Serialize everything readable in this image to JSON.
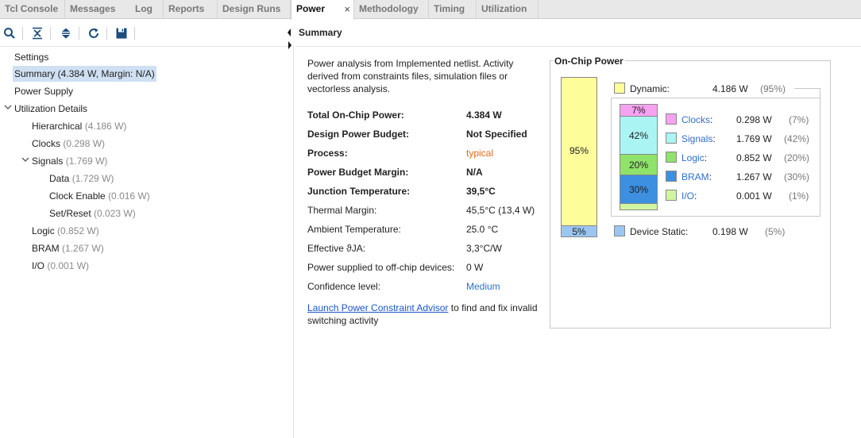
{
  "tabs": [
    {
      "label": "Tcl Console",
      "active": false
    },
    {
      "label": "Messages",
      "active": false
    },
    {
      "label": "Log",
      "active": false
    },
    {
      "label": "Reports",
      "active": false
    },
    {
      "label": "Design Runs",
      "active": false
    },
    {
      "label": "Power",
      "active": true
    },
    {
      "label": "Methodology",
      "active": false
    },
    {
      "label": "Timing",
      "active": false
    },
    {
      "label": "Utilization",
      "active": false
    }
  ],
  "tab_close_glyph": "×",
  "toolbar_icons": [
    "search-icon",
    "collapse-all-icon",
    "expand-all-icon",
    "refresh-icon",
    "save-icon"
  ],
  "tree": {
    "settings": "Settings",
    "summary": "Summary (4.384 W, Margin: N/A)",
    "power_supply": "Power Supply",
    "utilization_details": "Utilization Details",
    "hierarchical": {
      "name": "Hierarchical",
      "value": "(4.186 W)"
    },
    "clocks": {
      "name": "Clocks",
      "value": "(0.298 W)"
    },
    "signals": {
      "name": "Signals",
      "value": "(1.769 W)"
    },
    "data": {
      "name": "Data",
      "value": "(1.729 W)"
    },
    "clock_enable": {
      "name": "Clock Enable",
      "value": "(0.016 W)"
    },
    "set_reset": {
      "name": "Set/Reset",
      "value": "(0.023 W)"
    },
    "logic": {
      "name": "Logic",
      "value": "(0.852 W)"
    },
    "bram": {
      "name": "BRAM",
      "value": "(1.267 W)"
    },
    "io": {
      "name": "I/O",
      "value": "(0.001 W)"
    }
  },
  "summary": {
    "header": "Summary",
    "intro": "Power analysis from Implemented netlist. Activity derived from constraints files, simulation files or vectorless analysis.",
    "rows": [
      {
        "label": "Total On-Chip Power:",
        "value": "4.384 W"
      },
      {
        "label": "Design Power Budget:",
        "value": "Not Specified"
      },
      {
        "label": "Process:",
        "value": "typical"
      },
      {
        "label": "Power Budget Margin:",
        "value": "N/A"
      },
      {
        "label": "Junction Temperature:",
        "value": "39,5°C"
      },
      {
        "label": "Thermal Margin:",
        "value": "45,5°C (13,4 W)"
      },
      {
        "label": "Ambient Temperature:",
        "value": "25.0 °C"
      },
      {
        "label": "Effective ϑJA:",
        "value": "3,3°C/W"
      },
      {
        "label": "Power supplied to off-chip devices:",
        "value": "0 W"
      },
      {
        "label": "Confidence level:",
        "value": "Medium"
      }
    ],
    "link": "Launch Power Constraint Advisor",
    "link_suffix": " to find and fix invalid switching activity"
  },
  "on_chip_power": {
    "title": "On-Chip Power",
    "dynamic": {
      "label": "Dynamic:",
      "value": "4.186 W",
      "pct": "(95%)",
      "bar_label": "95%",
      "fraction": 0.95
    },
    "static": {
      "label": "Device Static:",
      "value": "0.198 W",
      "pct": "(5%)",
      "bar_label": "5%",
      "fraction": 0.05
    },
    "breakdown": [
      {
        "name": "Clocks",
        "value": "0.298 W",
        "pct": "(7%)",
        "bar_label": "7%",
        "color": "#f5a3f0",
        "fraction": 0.07
      },
      {
        "name": "Signals",
        "value": "1.769 W",
        "pct": "(42%)",
        "bar_label": "42%",
        "color": "#aaf4f4",
        "fraction": 0.42
      },
      {
        "name": "Logic",
        "value": "0.852 W",
        "pct": "(20%)",
        "bar_label": "20%",
        "color": "#8fe26a",
        "fraction": 0.2
      },
      {
        "name": "BRAM",
        "value": "1.267 W",
        "pct": "(30%)",
        "bar_label": "30%",
        "color": "#3d8fe0",
        "fraction": 0.3
      },
      {
        "name": "I/O",
        "value": "0.001 W",
        "pct": "(1%)",
        "bar_label": "",
        "color": "#d2f5a0",
        "fraction": 0.01
      }
    ],
    "colon": ":",
    "colors": {
      "dynamic": "#fdfd9a",
      "static": "#9bc6f2"
    }
  }
}
